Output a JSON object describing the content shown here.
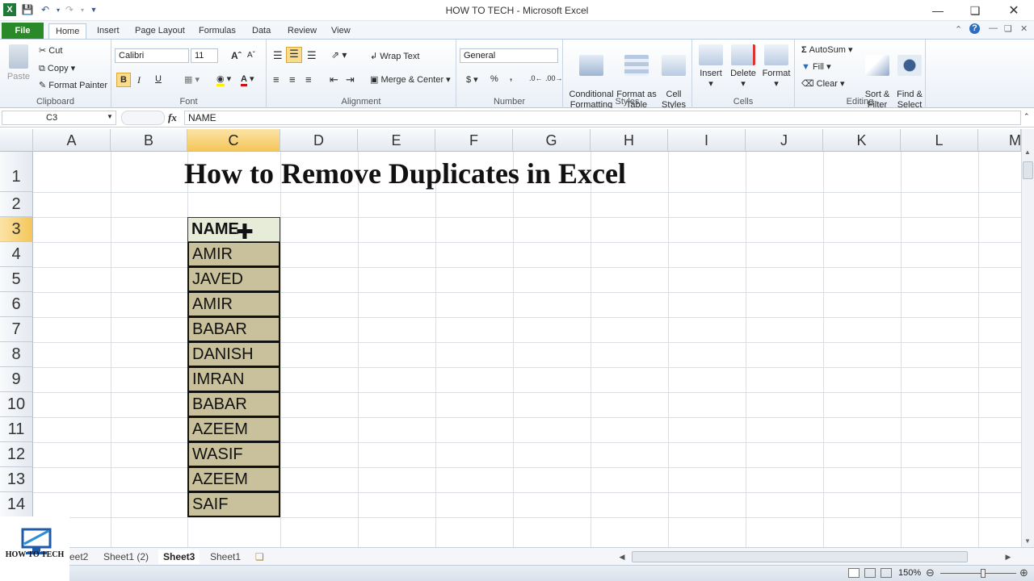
{
  "window": {
    "title": "HOW TO TECH  -  Microsoft Excel"
  },
  "tabs": [
    "File",
    "Home",
    "Insert",
    "Page Layout",
    "Formulas",
    "Data",
    "Review",
    "View"
  ],
  "clipboard": {
    "paste": "Paste",
    "cut": "Cut",
    "copy": "Copy",
    "format_painter": "Format Painter",
    "label": "Clipboard"
  },
  "font": {
    "name": "Calibri",
    "size": "11",
    "label": "Font",
    "bold": "B",
    "italic": "I",
    "underline": "U"
  },
  "alignment": {
    "wrap_text": "Wrap Text",
    "merge_center": "Merge & Center",
    "label": "Alignment"
  },
  "number": {
    "format": "General",
    "currency": "$",
    "percent": "%",
    "comma": ",",
    "label": "Number"
  },
  "styles": {
    "conditional": "Conditional\nFormatting",
    "format_table": "Format as\nTable",
    "cell_styles": "Cell\nStyles",
    "label": "Styles"
  },
  "cells": {
    "insert": "Insert",
    "delete": "Delete",
    "format": "Format",
    "label": "Cells"
  },
  "editing": {
    "autosum": "AutoSum",
    "fill": "Fill",
    "clear": "Clear",
    "sort_filter": "Sort &\nFilter",
    "find_select": "Find &\nSelect",
    "label": "Editing"
  },
  "formula_bar": {
    "name_box": "C3",
    "fx": "fx",
    "content": "NAME"
  },
  "columns": [
    "A",
    "B",
    "C",
    "D",
    "E",
    "F",
    "G",
    "H",
    "I",
    "J",
    "K",
    "L",
    "M"
  ],
  "rows": [
    "1",
    "2",
    "3",
    "4",
    "5",
    "6",
    "7",
    "8",
    "9",
    "10",
    "11",
    "12",
    "13",
    "14"
  ],
  "sheet_title": "How to Remove Duplicates in Excel",
  "header_cell": "NAME",
  "names": [
    "AMIR",
    "JAVED",
    "AMIR",
    "BABAR",
    "DANISH",
    "IMRAN",
    "BABAR",
    "AZEEM",
    "WASIF",
    "AZEEM",
    "SAIF"
  ],
  "sheet_tabs": [
    "eet2",
    "Sheet1 (2)",
    "Sheet3",
    "Sheet1"
  ],
  "logo": {
    "text": "HOW TO TECH"
  },
  "status": {
    "zoom": "150%"
  },
  "colors": {
    "file_tab": "#2a8a2a",
    "name_fill": "#c9c19c",
    "header_fill": "#e6ecd8",
    "selected_header": "#f5c659"
  }
}
